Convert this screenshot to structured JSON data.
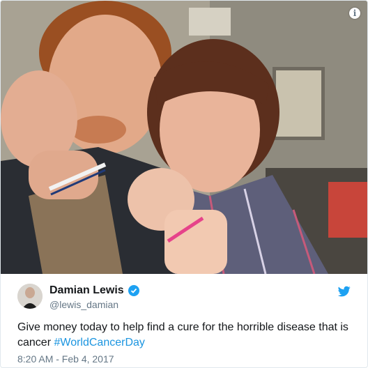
{
  "media": {
    "info_icon_glyph": "i",
    "info_icon": "info-icon"
  },
  "tweet": {
    "display_name": "Damian Lewis",
    "handle": "@lewis_damian",
    "verified": true,
    "text_main": "Give money today to help find a cure for the horrible disease that is cancer",
    "hashtag": "#WorldCancerDay",
    "timestamp": "8:20 AM - Feb 4, 2017",
    "avatar_icon": "avatar",
    "brand_icon": "twitter-bird-icon"
  },
  "colors": {
    "accent": "#1da1f2",
    "hashtag": "#1b95e0",
    "muted": "#657786",
    "text": "#14171a",
    "border": "#e1e8ed"
  }
}
